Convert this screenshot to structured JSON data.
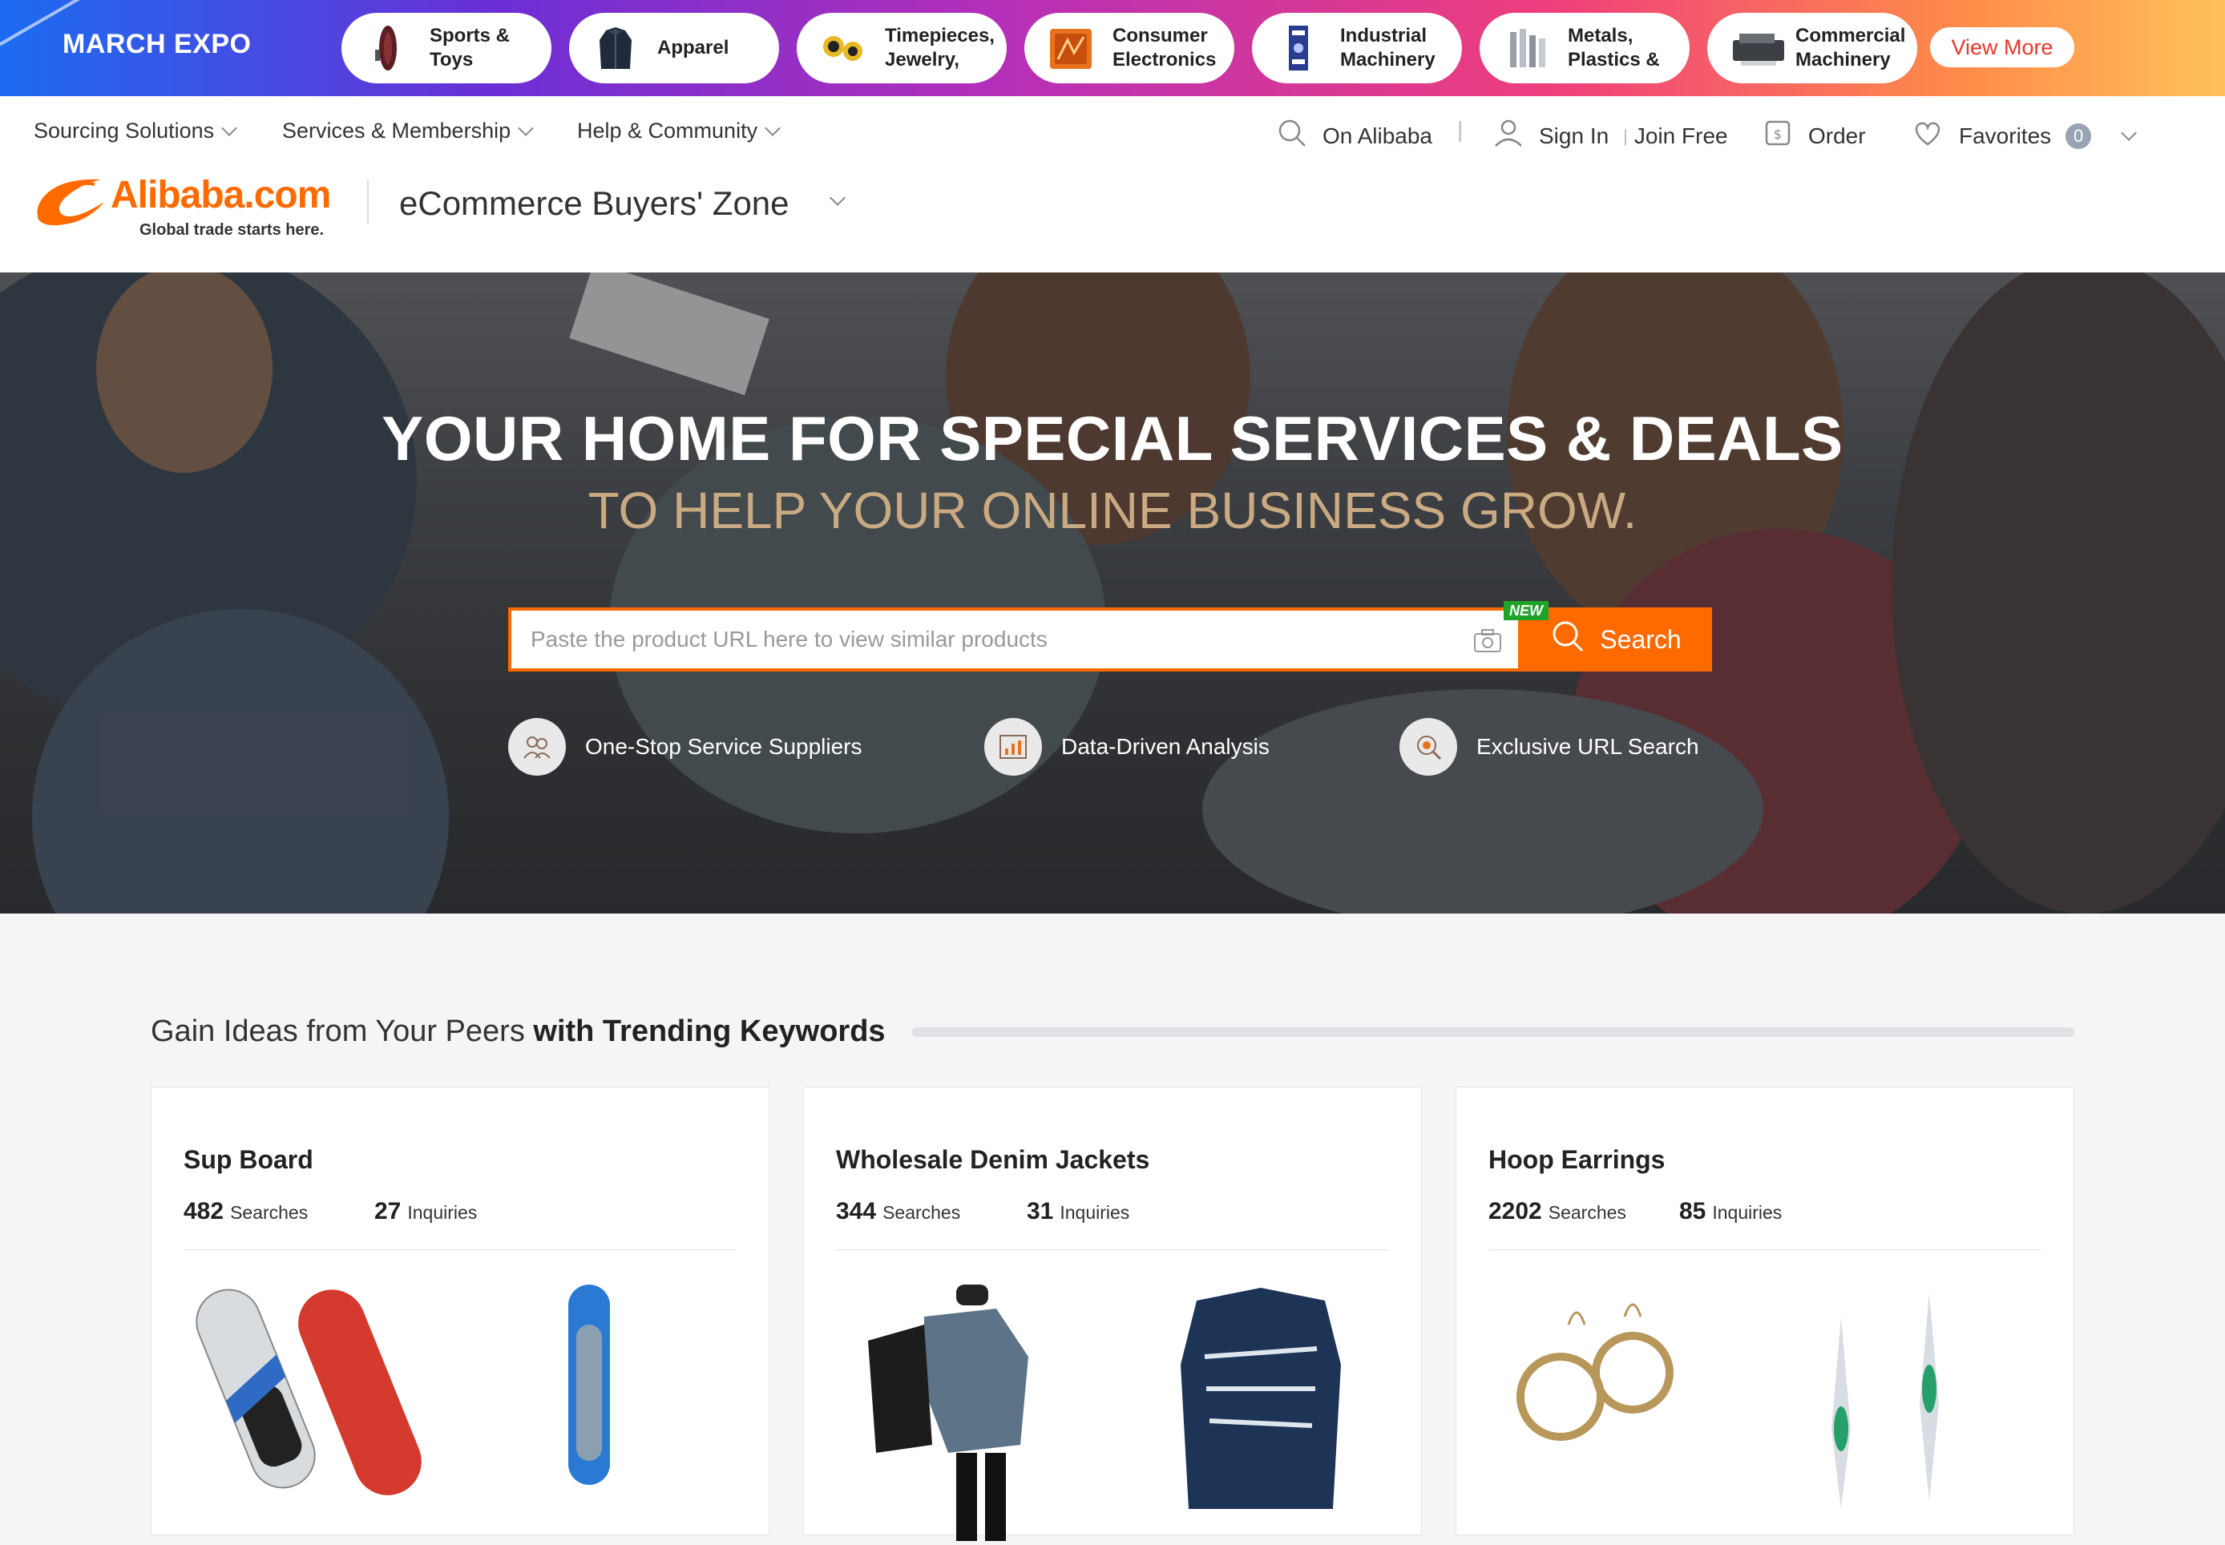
{
  "expo": {
    "title": "MARCH EXPO",
    "categories": [
      {
        "label": "Sports & Toys",
        "icon": "surfboard-icon"
      },
      {
        "label": "Apparel",
        "icon": "jacket-icon"
      },
      {
        "label": "Timepieces, Jewelry,",
        "icon": "watch-icon"
      },
      {
        "label": "Consumer Electronics",
        "icon": "electronics-icon"
      },
      {
        "label": "Industrial Machinery",
        "icon": "machine-icon"
      },
      {
        "label": "Metals, Plastics &",
        "icon": "metal-bars-icon"
      },
      {
        "label": "Commercial Machinery",
        "icon": "printer-machine-icon"
      }
    ],
    "view_more": "View More"
  },
  "nav": {
    "sourcing": "Sourcing Solutions",
    "services": "Services & Membership",
    "help": "Help & Community",
    "on_alibaba": "On Alibaba",
    "sign_in": "Sign In",
    "join_free": "Join Free",
    "order": "Order",
    "favorites": "Favorites",
    "favorites_count": "0"
  },
  "brand": {
    "logo_text": "Alibaba.com",
    "tagline": "Global trade starts here.",
    "zone": "eCommerce Buyers' Zone"
  },
  "hero": {
    "title": "YOUR HOME FOR SPECIAL SERVICES & DEALS",
    "subtitle": "TO HELP YOUR ONLINE BUSINESS GROW.",
    "search_placeholder": "Paste the product URL here to view similar products",
    "new_badge": "NEW",
    "search_button": "Search",
    "features": [
      "One-Stop Service Suppliers",
      "Data-Driven Analysis",
      "Exclusive URL Search"
    ]
  },
  "trending": {
    "title_plain": "Gain Ideas from Your Peers",
    "title_bold": "with Trending Keywords",
    "cards": [
      {
        "title": "Sup Board",
        "searches": "482",
        "searches_label": "Searches",
        "inquiries": "27",
        "inquiries_label": "Inquiries"
      },
      {
        "title": "Wholesale Denim Jackets",
        "searches": "344",
        "searches_label": "Searches",
        "inquiries": "31",
        "inquiries_label": "Inquiries"
      },
      {
        "title": "Hoop Earrings",
        "searches": "2202",
        "searches_label": "Searches",
        "inquiries": "85",
        "inquiries_label": "Inquiries"
      }
    ]
  },
  "colors": {
    "accent": "#ff6a00",
    "new_badge": "#20a32b",
    "view_more_text": "#e8362b",
    "subtitle_gold": "#c9aa82"
  }
}
